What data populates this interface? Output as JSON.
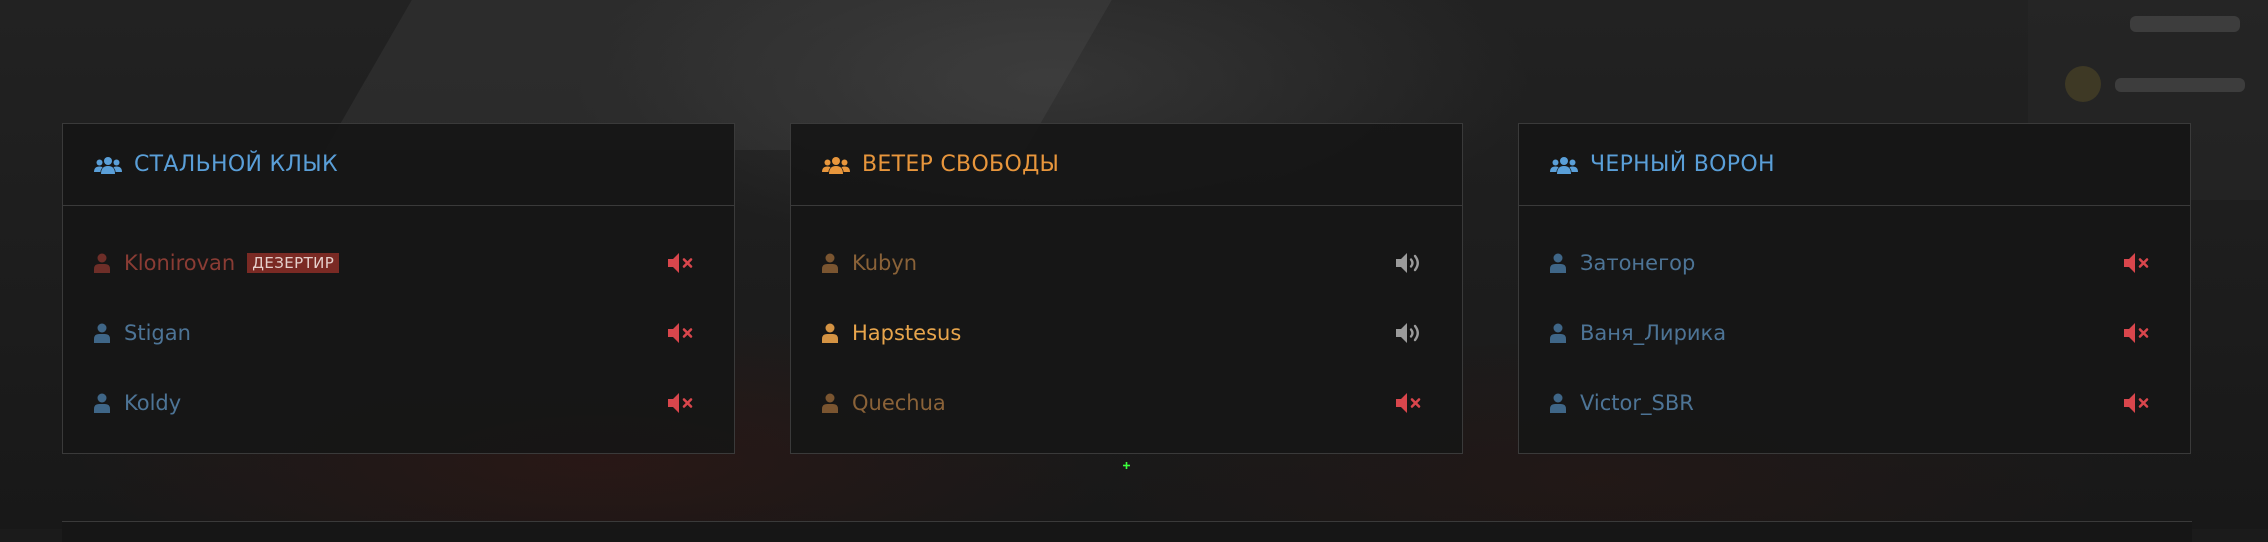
{
  "colors": {
    "blue_team": "#5a9fd8",
    "orange_team": "#e8963c",
    "deserter_name": "#8a3c34",
    "blue_player": "#4d7496",
    "orange_player_dim": "#8a6238",
    "orange_player_active": "#e8a54c",
    "muted_icon": "#d9464c",
    "speaker_icon": "#9b9b9b",
    "crosshair": "#3cff3c"
  },
  "teams": [
    {
      "name": "СТАЛЬНОЙ КЛЫК",
      "icon": "users-icon",
      "players": [
        {
          "name": "Klonirovan",
          "badge": "ДЕЗЕРТИР",
          "audio": "muted-icon"
        },
        {
          "name": "Stigan",
          "audio": "muted-icon"
        },
        {
          "name": "Koldy",
          "audio": "muted-icon"
        }
      ]
    },
    {
      "name": "ВЕТЕР СВОБОДЫ",
      "icon": "users-icon",
      "players": [
        {
          "name": "Kubyn",
          "audio": "speaker-icon"
        },
        {
          "name": "Hapstesus",
          "audio": "speaker-icon"
        },
        {
          "name": "Quechua",
          "audio": "muted-icon"
        }
      ]
    },
    {
      "name": "ЧЕРНЫЙ ВОРОН",
      "icon": "users-icon",
      "players": [
        {
          "name": "Затонегор",
          "audio": "muted-icon"
        },
        {
          "name": "Ваня_Лирика",
          "audio": "muted-icon"
        },
        {
          "name": "Victor_SBR",
          "audio": "muted-icon"
        }
      ]
    }
  ]
}
